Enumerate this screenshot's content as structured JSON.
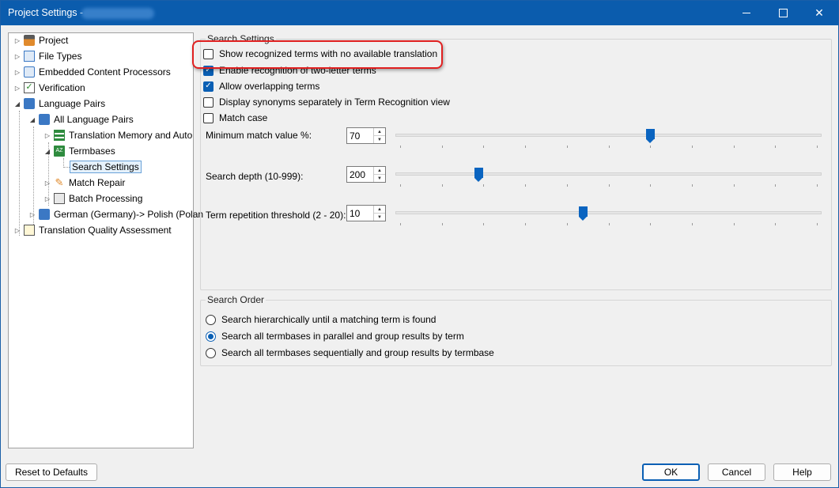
{
  "window": {
    "title": "Project Settings -",
    "colors": {
      "titlebar": "#0b5cad",
      "accent": "#0a5fb4",
      "highlight": "#e02020"
    },
    "controls": [
      "minimize-icon",
      "maximize-icon",
      "close-icon"
    ]
  },
  "tree": {
    "items": [
      {
        "label": "Project",
        "icon": "project-icon",
        "expander": "collapsed"
      },
      {
        "label": "File Types",
        "icon": "file-types-icon",
        "expander": "collapsed"
      },
      {
        "label": "Embedded Content Processors",
        "icon": "gear-icon",
        "expander": "collapsed"
      },
      {
        "label": "Verification",
        "icon": "verification-icon",
        "expander": "collapsed"
      },
      {
        "label": "Language Pairs",
        "icon": "language-pairs-icon",
        "expander": "expanded"
      },
      {
        "label": "All Language Pairs",
        "icon": "language-pairs-icon",
        "expander": "expanded"
      },
      {
        "label": "Translation Memory and Auto",
        "icon": "translation-memory-icon",
        "expander": "collapsed"
      },
      {
        "label": "Termbases",
        "icon": "termbase-icon",
        "expander": "expanded"
      },
      {
        "label": "Search Settings",
        "icon": "",
        "expander": "none",
        "selected": true
      },
      {
        "label": "Match Repair",
        "icon": "wrench-icon",
        "expander": "collapsed"
      },
      {
        "label": "Batch Processing",
        "icon": "batch-processing-icon",
        "expander": "collapsed"
      },
      {
        "label": "German (Germany)-> Polish (Polan",
        "icon": "language-pairs-icon",
        "expander": "collapsed"
      },
      {
        "label": "Translation Quality Assessment",
        "icon": "quality-assessment-icon",
        "expander": "collapsed"
      }
    ]
  },
  "search_settings": {
    "group_title": "Search Settings",
    "checkboxes": [
      {
        "label": "Show recognized terms with no available translation",
        "checked": false
      },
      {
        "label": "Enable recognition of two-letter terms",
        "checked": true
      },
      {
        "label": "Allow overlapping terms",
        "checked": true
      },
      {
        "label": "Display synonyms separately in Term Recognition view",
        "checked": false
      },
      {
        "label": "Match case",
        "checked": false
      }
    ],
    "min_match": {
      "label": "Minimum match value %:",
      "value": "70",
      "slider_fraction": 0.6
    },
    "search_depth": {
      "label": "Search depth (10-999):",
      "value": "200",
      "slider_fraction": 0.19
    },
    "term_repetition": {
      "label": "Term repetition threshold (2 - 20):",
      "value": "10",
      "slider_fraction": 0.44
    }
  },
  "search_order": {
    "group_title": "Search Order",
    "options": [
      {
        "label": "Search hierarchically until a matching term is found",
        "selected": false
      },
      {
        "label": "Search all termbases in parallel and group results by term",
        "selected": true
      },
      {
        "label": "Search all termbases sequentially and group results by termbase",
        "selected": false
      }
    ]
  },
  "buttons": {
    "reset": "Reset to Defaults",
    "ok": "OK",
    "cancel": "Cancel",
    "help": "Help"
  }
}
